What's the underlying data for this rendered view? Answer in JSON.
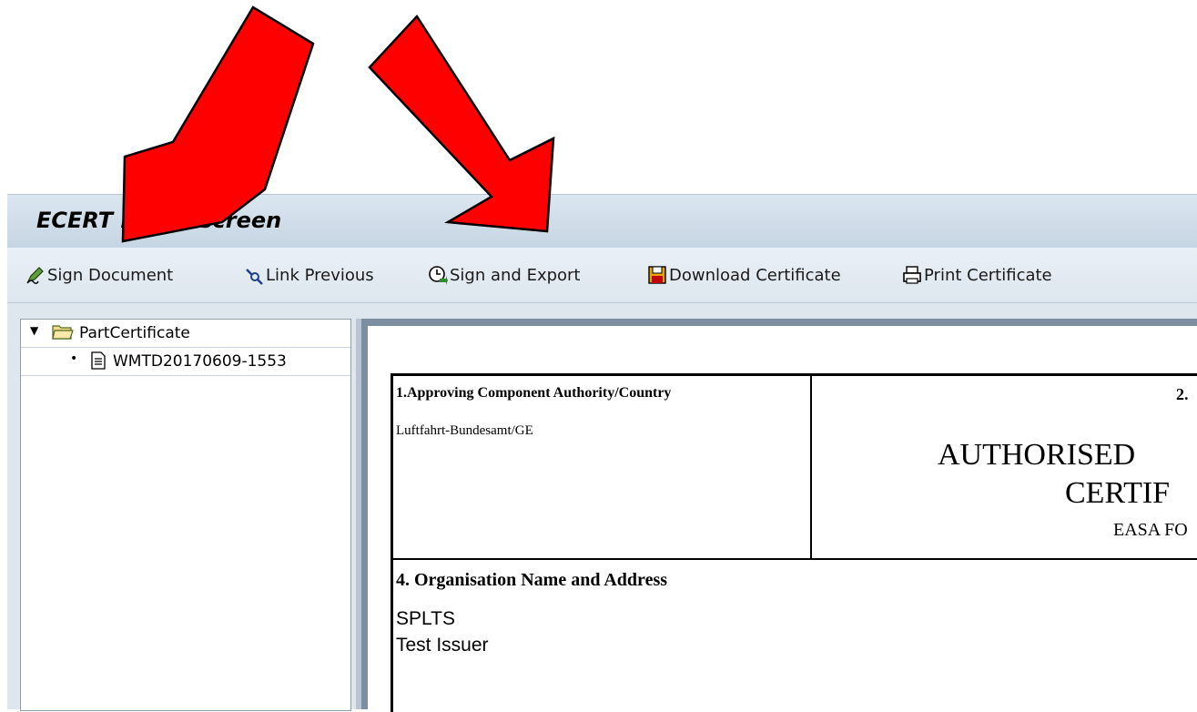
{
  "window": {
    "title": "ECERT Initial screen"
  },
  "toolbar": {
    "sign_document": "Sign Document",
    "link_previous": "Link Previous",
    "sign_and_export": "Sign and Export",
    "download_certificate": "Download Certificate",
    "print_certificate": "Print Certificate"
  },
  "tree": {
    "root": {
      "label": "PartCertificate",
      "icon": "folder-open-icon"
    },
    "child": {
      "label": "WMTD20170609-1553",
      "icon": "document-icon"
    }
  },
  "certificate": {
    "box1": {
      "heading": "1.Approving Component Authority/Country",
      "value": "Luftfahrt-Bundesamt/GE"
    },
    "box2": {
      "number": "2.",
      "title_line1": "AUTHORISED",
      "title_line2": "CERTIF",
      "form": "EASA FO"
    },
    "box4": {
      "heading": "4. Organisation Name and Address",
      "line1": "SPLTS",
      "line2": "Test Issuer"
    }
  },
  "colors": {
    "arrow": "#ff0000",
    "titlebar": "#cfdce8",
    "toolbar": "#e4ebf2",
    "doc_frame": "#7d8ea0"
  }
}
